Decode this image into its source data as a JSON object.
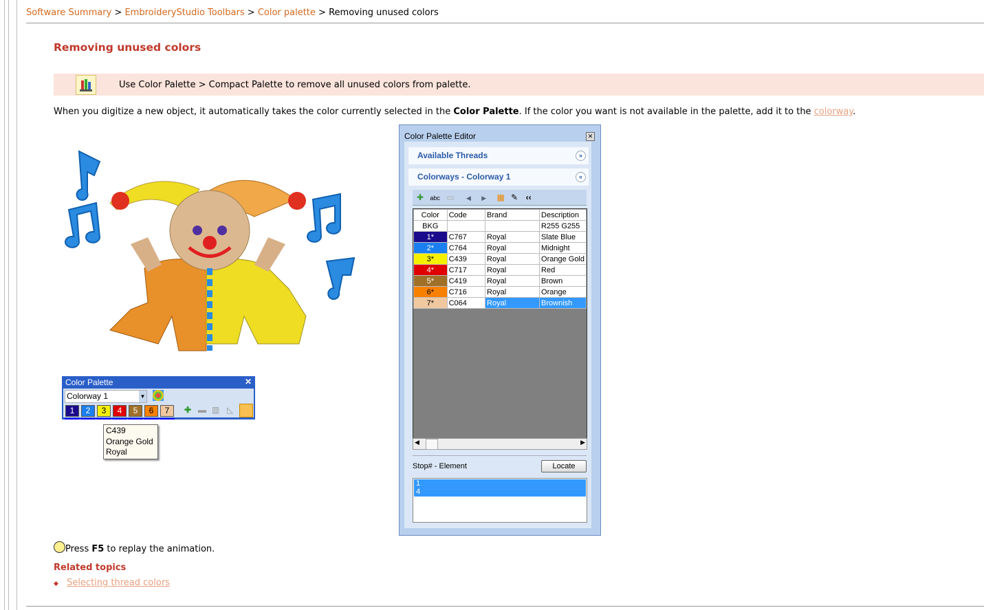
{
  "breadcrumb": {
    "items": [
      "Software Summary",
      "EmbroideryStudio Toolbars",
      "Color palette"
    ],
    "current": "Removing unused colors",
    "sep": ">"
  },
  "page_title": "Removing unused colors",
  "tip": {
    "text": "Use Color Palette > Compact Palette to remove all unused colors from palette."
  },
  "intro": {
    "part1": "When you digitize a new object, it automatically takes the color currently selected in the ",
    "bold": "Color Palette",
    "part2": ". If the color you want is not available in the palette, add it to the ",
    "link": "colorway",
    "end": "."
  },
  "editor": {
    "title": "Color Palette Editor",
    "available": "Available Threads",
    "colorways": "Colorways - Colorway 1",
    "columns": [
      "Color",
      "Code",
      "Brand",
      "Description"
    ],
    "rows": [
      {
        "color": "BKG",
        "swatch": "#ffffff",
        "code": "",
        "brand": "",
        "desc": "R255 G255",
        "text": "#000"
      },
      {
        "color": "1*",
        "swatch": "#1a0a8c",
        "code": "C767",
        "brand": "Royal",
        "desc": "Slate Blue",
        "text": "#fff"
      },
      {
        "color": "2*",
        "swatch": "#1a7ff0",
        "code": "C764",
        "brand": "Royal",
        "desc": "Midnight",
        "text": "#fff"
      },
      {
        "color": "3*",
        "swatch": "#f5f000",
        "code": "C439",
        "brand": "Royal",
        "desc": "Orange Gold",
        "text": "#000"
      },
      {
        "color": "4*",
        "swatch": "#e00000",
        "code": "C717",
        "brand": "Royal",
        "desc": "Red",
        "text": "#fff"
      },
      {
        "color": "5*",
        "swatch": "#a07028",
        "code": "C419",
        "brand": "Royal",
        "desc": "Brown",
        "text": "#fff"
      },
      {
        "color": "6*",
        "swatch": "#f88000",
        "code": "C716",
        "brand": "Royal",
        "desc": "Orange",
        "text": "#000"
      },
      {
        "color": "7*",
        "swatch": "#f0c8a0",
        "code": "C064",
        "brand": "Royal",
        "desc": "Brownish",
        "text": "#000"
      }
    ],
    "stop_label": "Stop# - Element",
    "locate": "Locate",
    "stops": [
      "1",
      "4"
    ]
  },
  "palette": {
    "title": "Color Palette",
    "colorway": "Colorway 1",
    "close": "✕",
    "swatches": [
      {
        "n": "1",
        "c": "#1a0a8c",
        "t": "#fff"
      },
      {
        "n": "2",
        "c": "#1a7ff0",
        "t": "#fff"
      },
      {
        "n": "3",
        "c": "#f5f000",
        "t": "#000"
      },
      {
        "n": "4",
        "c": "#e00000",
        "t": "#fff"
      },
      {
        "n": "5",
        "c": "#a07028",
        "t": "#fff"
      },
      {
        "n": "6",
        "c": "#f88000",
        "t": "#000"
      },
      {
        "n": "7",
        "c": "#f0c8a0",
        "t": "#000"
      }
    ],
    "tooltip": [
      "C439",
      "Orange Gold",
      "Royal"
    ]
  },
  "hint": {
    "pre": "Press ",
    "key": "F5",
    "post": " to replay the animation."
  },
  "related": {
    "title": "Related topics",
    "links": [
      "Selecting thread colors"
    ]
  },
  "colors": {
    "accent": "#c0392b",
    "link": "#d2691e",
    "selection": "#3399ff"
  }
}
